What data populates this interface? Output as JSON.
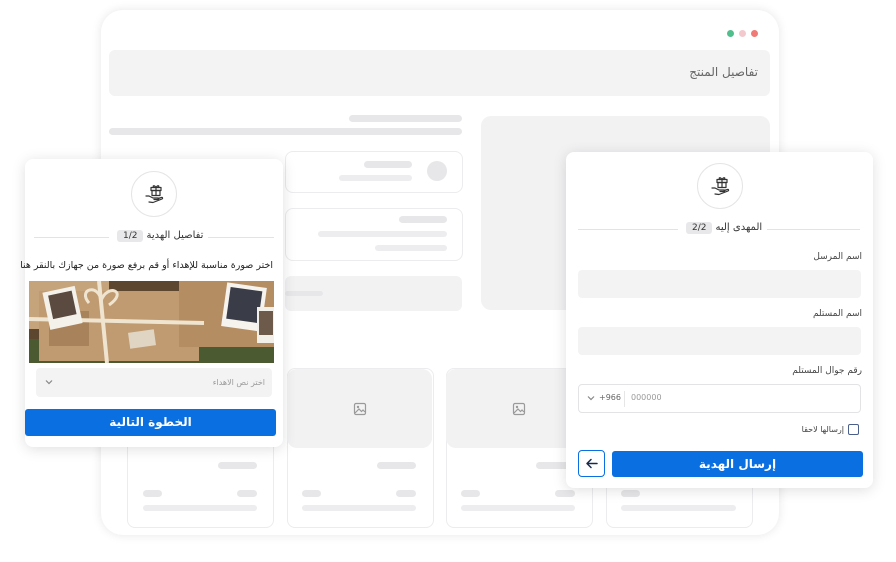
{
  "background_window": {
    "title": "تفاصيل المنتج",
    "window_dots": {
      "green": "#4fc08d",
      "pink": "#f4c9cd",
      "red": "#ef7a76"
    }
  },
  "left_card": {
    "step_badge": "1/2",
    "step_title": "تفاصيل الهدية",
    "instruction": "اختر صورة مناسبة للإهداء أو قم برفع صورة من جهازك بالنقر هنا",
    "message_select_placeholder": "اختر نص الاهداء",
    "next_button": "الخطوة التالية",
    "icon": "gift-hand-icon"
  },
  "right_card": {
    "step_badge": "2/2",
    "step_title": "المهدى إليه",
    "sender_label": "اسم المرسل",
    "sender_value": "",
    "recipient_label": "اسم المستلم",
    "recipient_value": "",
    "phone_label": "رقم جوال المستلم",
    "country_code": "+966",
    "phone_placeholder": "000000",
    "send_later_label": "إرسالها لاحقا",
    "send_button": "إرسال الهدية",
    "back_icon": "arrow-left-icon",
    "icon": "gift-hand-icon"
  },
  "colors": {
    "accent": "#0a6fe0"
  }
}
